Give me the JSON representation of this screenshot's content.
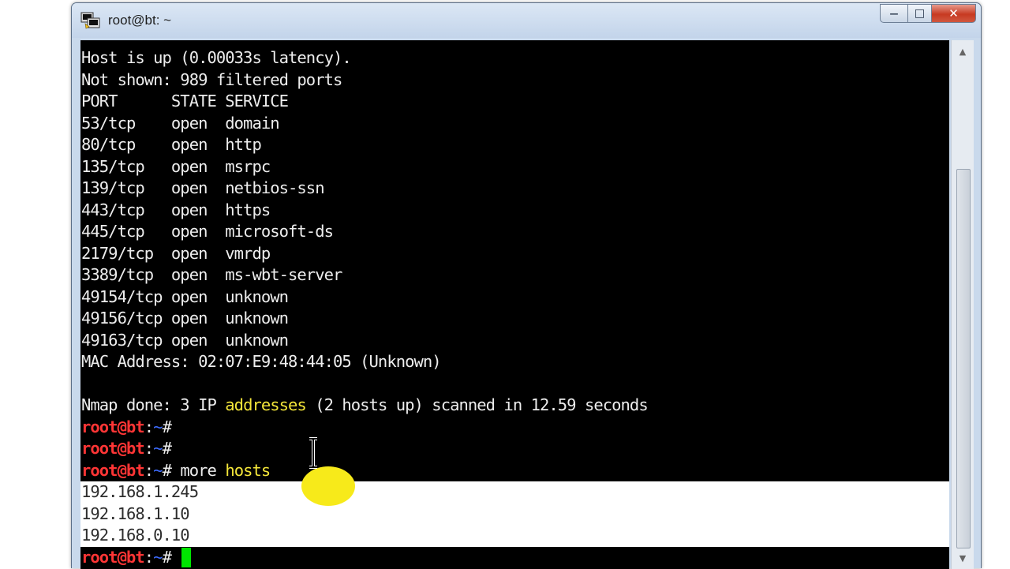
{
  "window": {
    "title": "root@bt: ~",
    "controls": {
      "minimize": "—",
      "maximize": "□",
      "close": "✕"
    }
  },
  "icons": {
    "app": "putty-terminal-icon",
    "pointer": "ibeam-cursor-icon"
  },
  "prompt": {
    "user_host": "root@bt",
    "sep": ":",
    "path": "~",
    "sign": "#"
  },
  "terminal_lines": [
    "Host is up (0.00033s latency).",
    "Not shown: 989 filtered ports",
    "PORT      STATE SERVICE",
    "53/tcp    open  domain",
    "80/tcp    open  http",
    "135/tcp   open  msrpc",
    "139/tcp   open  netbios-ssn",
    "443/tcp   open  https",
    "445/tcp   open  microsoft-ds",
    "2179/tcp  open  vmrdp",
    "3389/tcp  open  ms-wbt-server",
    "49154/tcp open  unknown",
    "49156/tcp open  unknown",
    "49163/tcp open  unknown",
    "MAC Address: 02:07:E9:48:44:05 (Unknown)"
  ],
  "summary": {
    "pre": "Nmap done: 3 IP ",
    "hl": "addresses",
    "post": " (2 hosts up) scanned in 12.59 seconds"
  },
  "command": {
    "pre": " more ",
    "hl": "hosts"
  },
  "hosts_output": [
    "192.168.1.245",
    "192.168.1.10",
    "192.168.0.10"
  ],
  "colors": {
    "prompt_user": "#ff3535",
    "prompt_path": "#3d6cff",
    "highlight": "#f4e63a",
    "cursor": "#00e600",
    "terminal_bg": "#000000",
    "spotlight": "#f7ea1a"
  }
}
